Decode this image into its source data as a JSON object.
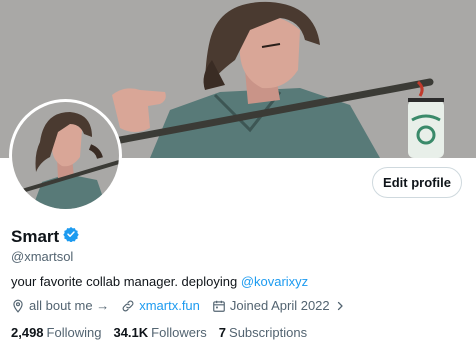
{
  "profile": {
    "display_name": "Smart",
    "handle": "@xmartsol",
    "bio_text": "your favorite collab manager. deploying ",
    "bio_mention": "@kovarixyz",
    "edit_button": "Edit profile",
    "location": "all bout me →",
    "website": "xmartx.fun",
    "joined": "Joined April 2022",
    "verified_color": "#1d9bf0"
  },
  "stats": [
    {
      "value": "2,498",
      "label": "Following"
    },
    {
      "value": "34.1K",
      "label": "Followers"
    },
    {
      "value": "7",
      "label": "Subscriptions"
    }
  ],
  "icons": {
    "verified": "verified-badge-icon",
    "location": "location-pin-icon",
    "link": "link-icon",
    "calendar": "calendar-icon",
    "chevron": "chevron-right-icon"
  }
}
